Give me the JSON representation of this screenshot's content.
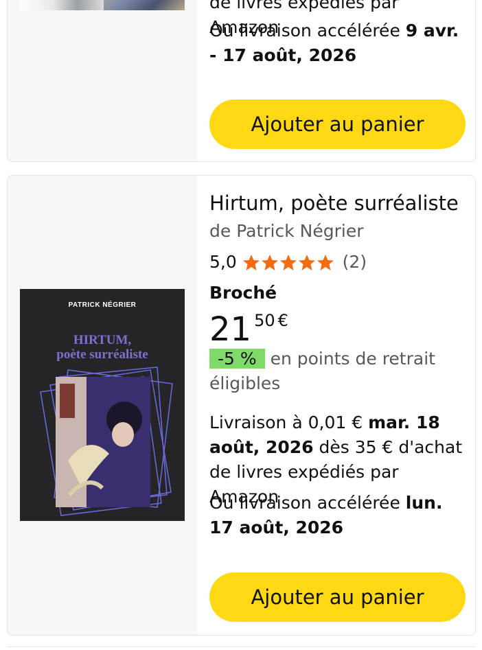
{
  "card1": {
    "shipping_partial": "de livres expédiés par Amazon",
    "express_prefix": "Ou livraison accélérée ",
    "express_date": "9 avr. - 17 août, 2026",
    "add_to_cart": "Ajouter au panier"
  },
  "card2": {
    "title": "Hirtum, poète surréaliste",
    "author": "de Patrick Négrier",
    "rating": "5,0",
    "rating_value": 5,
    "rating_count": "(2)",
    "format": "Broché",
    "price_whole": "21",
    "price_fraction": "50",
    "price_currency": "€",
    "discount_badge": "-5 %",
    "discount_text": "en points de retrait éligibles",
    "delivery_prefix": "Livraison à 0,01 € ",
    "delivery_date": "mar. 18 août, 2026",
    "delivery_suffix": " dès 35 € d'achat de livres expédiés par Amazon",
    "express_prefix": "Ou livraison accélérée ",
    "express_date": "lun. 17 août, 2026",
    "add_to_cart": "Ajouter au panier",
    "cover": {
      "author": "PATRICK NÉGRIER",
      "title_line1": "HIRTUM,",
      "title_line2": "poète surréaliste"
    }
  },
  "colors": {
    "button": "#ffd814",
    "star": "#f46b12",
    "badge": "#7fda69",
    "image_panel": "#f7f7f7"
  }
}
